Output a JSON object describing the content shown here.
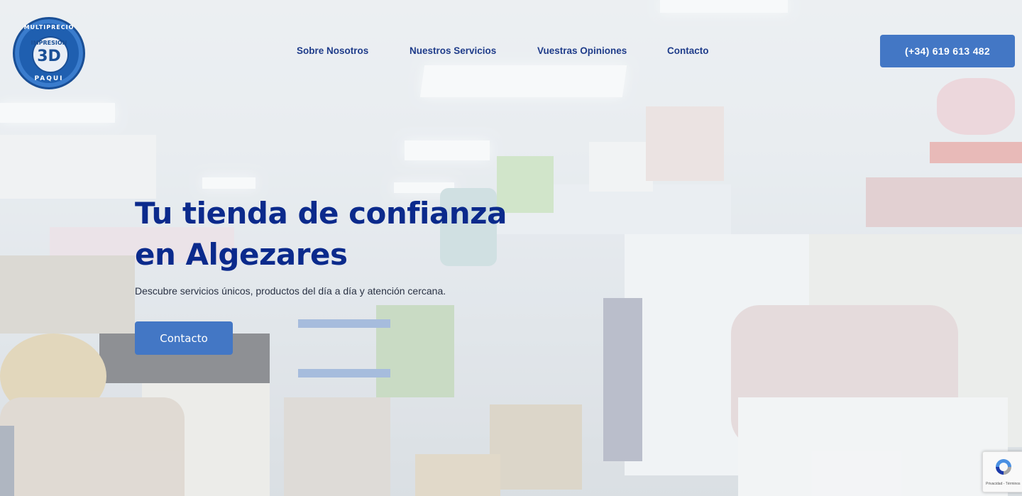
{
  "logo": {
    "top_text": "MULTIPRECIO",
    "mid_text": "IMPRESIÓN",
    "big_text": "3D",
    "bottom_text": "PAQUI"
  },
  "nav": {
    "items": [
      {
        "label": "Sobre Nosotros"
      },
      {
        "label": "Nuestros Servicios"
      },
      {
        "label": "Vuestras Opiniones"
      },
      {
        "label": "Contacto"
      }
    ],
    "phone": "(+34) 619 613 482"
  },
  "hero": {
    "title_line1": "Tu tienda de confianza",
    "title_line2": "en Algezares",
    "subtitle": "Descubre servicios únicos, productos del día a día y atención cercana.",
    "cta_label": "Contacto"
  },
  "recaptcha": {
    "footer_text": "Privacidad - Términos"
  },
  "colors": {
    "accent": "#4377c5",
    "title": "#0b2a8c",
    "nav": "#1f3c8a"
  }
}
